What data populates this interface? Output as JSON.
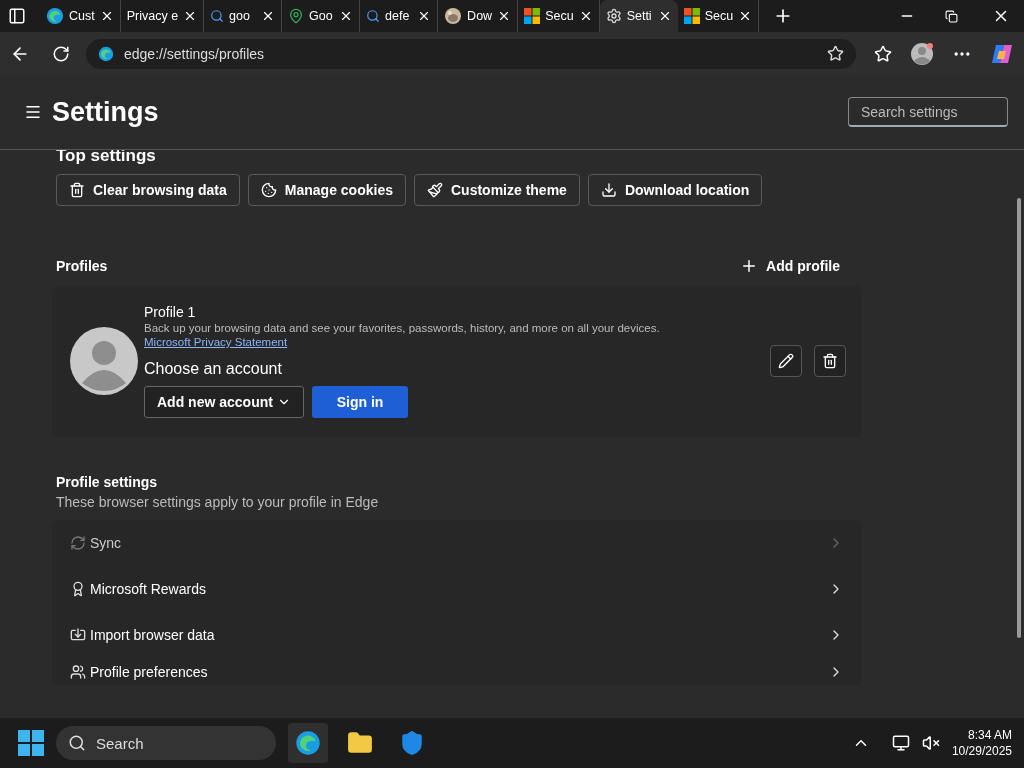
{
  "tabs": [
    {
      "kind": "edge",
      "title": "Cust",
      "selected": false
    },
    {
      "kind": "plain",
      "title": "Privacy e",
      "selected": false
    },
    {
      "kind": "search",
      "title": "goo",
      "selected": false
    },
    {
      "kind": "maps",
      "title": "Goo",
      "selected": false
    },
    {
      "kind": "search",
      "title": "defe",
      "selected": false
    },
    {
      "kind": "picture",
      "title": "Dow",
      "selected": false
    },
    {
      "kind": "microsoft",
      "title": "Secu",
      "selected": false
    },
    {
      "kind": "gear",
      "title": "Setti",
      "selected": true
    },
    {
      "kind": "microsoft",
      "title": "Secu",
      "selected": false
    }
  ],
  "address_bar": {
    "url": "edge://settings/profiles"
  },
  "settings": {
    "title": "Settings",
    "search": {
      "placeholder": "Search settings"
    }
  },
  "top_settings": {
    "heading": "Top settings",
    "buttons": [
      {
        "kind": "trash",
        "label": "Clear browsing data"
      },
      {
        "kind": "cookie",
        "label": "Manage cookies"
      },
      {
        "kind": "brush",
        "label": "Customize theme"
      },
      {
        "kind": "download",
        "label": "Download location"
      }
    ]
  },
  "profiles": {
    "heading": "Profiles",
    "add_button": "Add profile",
    "card": {
      "name": "Profile 1",
      "description": "Back up your browsing data and see your favorites, passwords, history, and more on all your devices.",
      "link": "Microsoft Privacy Statement",
      "choose_label": "Choose an account",
      "account_dropdown": "Add new account",
      "sign_in_button": "Sign in"
    }
  },
  "profile_settings": {
    "heading": "Profile settings",
    "subtitle": "These browser settings apply to your profile in Edge",
    "items": [
      {
        "kind": "sync",
        "label": "Sync",
        "disabled": true
      },
      {
        "kind": "rewards",
        "label": "Microsoft Rewards",
        "disabled": false
      },
      {
        "kind": "import",
        "label": "Import browser data",
        "disabled": false
      },
      {
        "kind": "people",
        "label": "Profile preferences",
        "disabled": false
      }
    ]
  },
  "taskbar": {
    "search": "Search",
    "apps": [
      {
        "kind": "edge",
        "active": true
      },
      {
        "kind": "folder",
        "active": false
      },
      {
        "kind": "security",
        "active": false
      }
    ],
    "time": "8:34 AM",
    "date": "10/29/2025"
  }
}
